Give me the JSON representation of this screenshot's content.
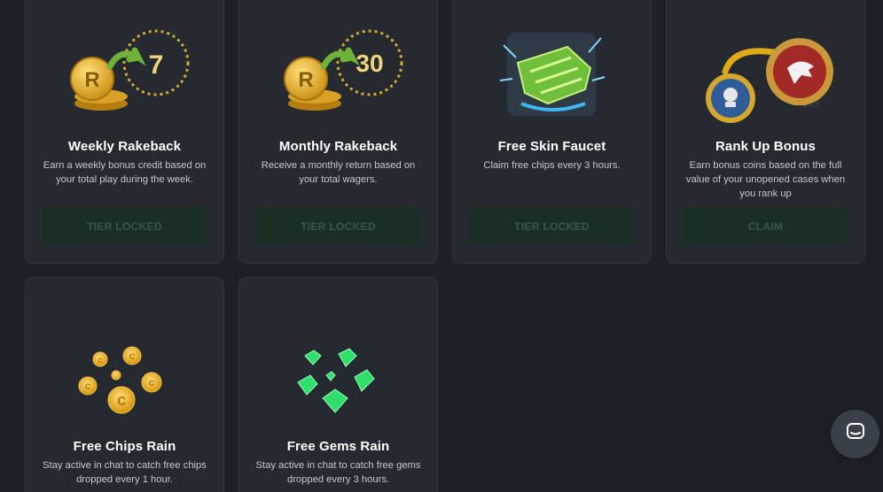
{
  "rewards": [
    {
      "title": "Weekly Rakeback",
      "description": "Earn a weekly bonus credit based on your total play during the week.",
      "button_label": "TIER LOCKED",
      "badge_text": "7",
      "icon": "coin-stack-7-day-icon"
    },
    {
      "title": "Monthly Rakeback",
      "description": "Receive a monthly return based on your total wagers.",
      "button_label": "TIER LOCKED",
      "badge_text": "30",
      "icon": "coin-stack-30-day-icon"
    },
    {
      "title": "Free Skin Faucet",
      "description": "Claim free chips every 3 hours.",
      "button_label": "TIER LOCKED",
      "icon": "glove-skin-icon"
    },
    {
      "title": "Rank Up Bonus",
      "description": "Earn bonus coins based on the full value of your unopened cases when you rank up",
      "button_label": "CLAIM",
      "icon": "rank-up-badge-icon"
    },
    {
      "title": "Free Chips Rain",
      "description": "Stay active in chat to catch free chips dropped every 1 hour.",
      "icon": "falling-coins-icon"
    },
    {
      "title": "Free Gems Rain",
      "description": "Stay active in chat to catch free gems dropped every 3 hours.",
      "icon": "falling-gems-icon"
    }
  ],
  "chat": {
    "icon": "chat-bubble-icon"
  },
  "colors": {
    "background": "#1d2127",
    "card": "#252a31",
    "button_bg": "#1a2e25",
    "button_text": "#37574a",
    "accent_red": "#e0433e",
    "gold": "#e9b22b",
    "gem_green": "#2ee06a"
  }
}
